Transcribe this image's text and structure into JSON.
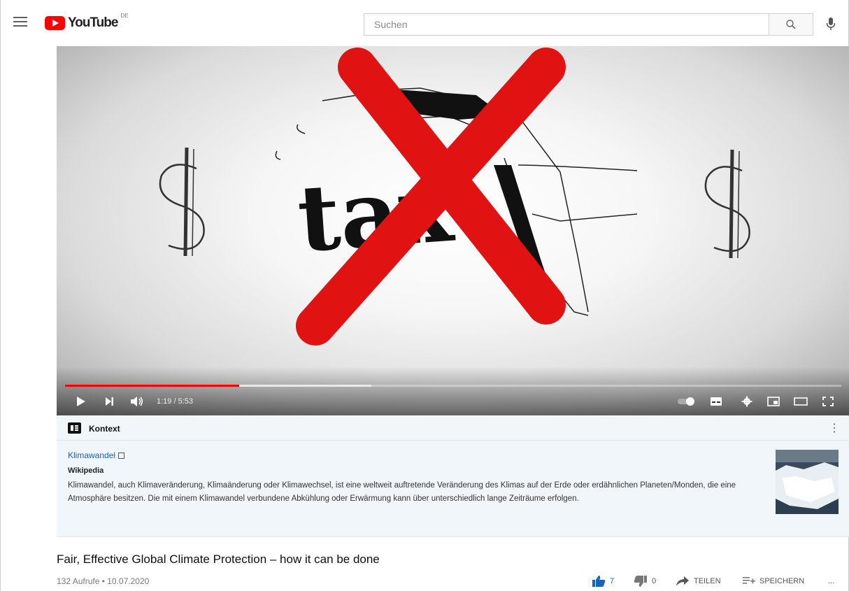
{
  "header": {
    "logo_text": "YouTube",
    "region_code": "DE",
    "search_placeholder": "Suchen"
  },
  "player": {
    "current_time": "1:19",
    "duration": "5:53",
    "time_display": "1:19 / 5:53",
    "progress_fraction": 0.224,
    "buffered_fraction": 0.395,
    "thumbnail_text": "tax",
    "colors": {
      "progress_played": "#ff0000",
      "cross": "#e01212"
    }
  },
  "context_panel": {
    "title": "Kontext",
    "topic_link": "Klimawandel",
    "source": "Wikipedia",
    "description": "Klimawandel, auch Klimaveränderung, Klimaänderung oder Klimawechsel, ist eine weltweit auftretende Veränderung des Klimas auf der Erde oder erdähnlichen Planeten/Monden, die eine Atmosphäre besitzen. Die mit einem Klimawandel verbundene Abkühlung oder Erwärmung kann über unterschiedlich lange Zeiträume erfolgen."
  },
  "video": {
    "title": "Fair, Effective Global Climate Protection – how it can be done",
    "views": "132 Aufrufe",
    "date": "10.07.2020",
    "meta": "132 Aufrufe • 10.07.2020",
    "likes": "7",
    "dislikes": "0",
    "share_label": "TEILEN",
    "save_label": "SPEICHERN",
    "more_label": "..."
  }
}
